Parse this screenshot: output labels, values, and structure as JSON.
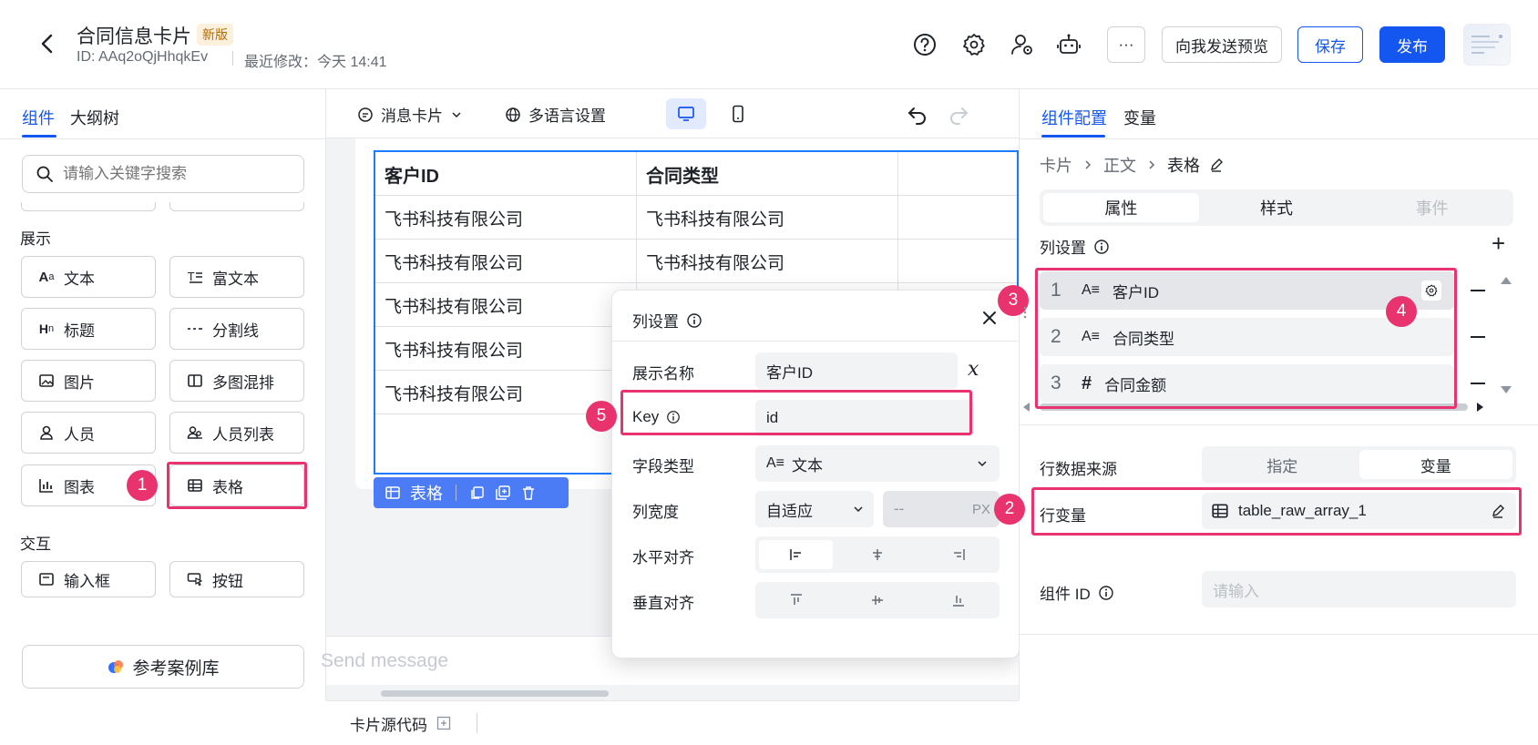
{
  "header": {
    "title": "合同信息卡片",
    "badge": "新版",
    "doc_id": "ID: AAq2oQjHhqkEv",
    "last_modified": "最近修改：今天 14:41",
    "more_label": "···",
    "preview_label": "向我发送预览",
    "save_label": "保存",
    "publish_label": "发布"
  },
  "left_panel": {
    "tabs": [
      "组件",
      "大纲树"
    ],
    "search_placeholder": "请输入关键字搜索",
    "display_section": "展示",
    "interact_section": "交互",
    "components": [
      {
        "label": "文本",
        "icon": "Aa"
      },
      {
        "label": "富文本",
        "icon": "≡"
      },
      {
        "label": "标题",
        "icon": "Hn"
      },
      {
        "label": "分割线",
        "icon": "---"
      },
      {
        "label": "图片",
        "icon": "image-icon"
      },
      {
        "label": "多图混排",
        "icon": "columns-icon"
      },
      {
        "label": "人员",
        "icon": "person-icon"
      },
      {
        "label": "人员列表",
        "icon": "people-icon"
      },
      {
        "label": "图表",
        "icon": "chart-icon"
      },
      {
        "label": "表格",
        "icon": "table-icon"
      }
    ],
    "interact_components": [
      {
        "label": "输入框",
        "icon": "input-icon"
      },
      {
        "label": "按钮",
        "icon": "button-icon"
      }
    ],
    "reference_label": "参考案例库"
  },
  "center": {
    "card_type": "消息卡片",
    "i18n_label": "多语言设置",
    "table": {
      "headers": [
        "客户ID",
        "合同类型",
        ""
      ],
      "rows": [
        [
          "飞书科技有限公司",
          "飞书科技有限公司",
          ""
        ],
        [
          "飞书科技有限公司",
          "飞书科技有限公司",
          ""
        ],
        [
          "飞书科技有限公司",
          "",
          ""
        ],
        [
          "飞书科技有限公司",
          "",
          ""
        ],
        [
          "飞书科技有限公司",
          "",
          ""
        ]
      ]
    },
    "table_tool_label": "表格",
    "send_placeholder": "Send message",
    "source_code_label": "卡片源代码"
  },
  "popup": {
    "title": "列设置",
    "display_name_label": "展示名称",
    "display_name_value": "客户ID",
    "key_label": "Key",
    "key_value": "id",
    "field_type_label": "字段类型",
    "field_type_value": "文本",
    "field_type_icon": "A≡",
    "width_label": "列宽度",
    "width_value": "自适应",
    "width_px_placeholder": "--",
    "width_px_unit": "PX",
    "h_align_label": "水平对齐",
    "v_align_label": "垂直对齐",
    "formula_glyph": "𝑥"
  },
  "right_panel": {
    "tabs": [
      "组件配置",
      "变量"
    ],
    "breadcrumb": [
      "卡片",
      "正文",
      "表格"
    ],
    "segments": [
      "属性",
      "样式",
      "事件"
    ],
    "col_settings_label": "列设置",
    "add_label": "+",
    "columns": [
      {
        "index": "1",
        "icon": "A≡",
        "name": "客户ID"
      },
      {
        "index": "2",
        "icon": "A≡",
        "name": "合同类型"
      },
      {
        "index": "3",
        "icon": "#",
        "name": "合同金额"
      }
    ],
    "row_source_label": "行数据来源",
    "row_source_options": [
      "指定",
      "变量"
    ],
    "row_variable_label": "行变量",
    "row_variable_value": "table_raw_array_1",
    "component_id_label": "组件 ID",
    "component_id_placeholder": "请输入"
  },
  "annotations": [
    "1",
    "2",
    "3",
    "4",
    "5"
  ],
  "colors": {
    "accent": "#1456f0",
    "annotation": "#e8336e",
    "selection": "#1d7bff"
  }
}
